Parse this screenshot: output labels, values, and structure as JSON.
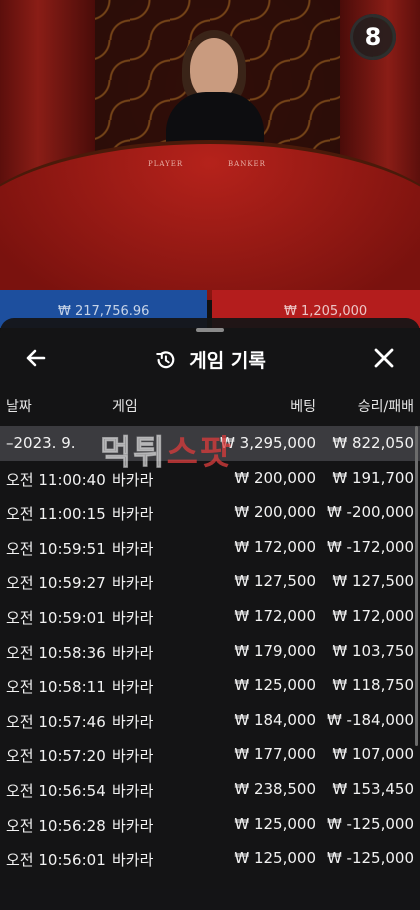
{
  "game_view": {
    "timer_value": "8",
    "player_total": "₩ 217,756.96",
    "banker_total": "₩ 1,205,000",
    "table_labels": [
      "PLAYER",
      "BANKER"
    ]
  },
  "modal": {
    "title": "게임 기록",
    "columns": {
      "date": "날짜",
      "game": "게임",
      "bet": "베팅",
      "win_loss": "승리/패배"
    },
    "rows": [
      {
        "date": "–2023. 9.",
        "game": "",
        "bet": "₩ 3,295,000",
        "win_loss": "₩ 822,050"
      },
      {
        "date": "오전 11:00:40",
        "game": "바카라",
        "bet": "₩ 200,000",
        "win_loss": "₩ 191,700"
      },
      {
        "date": "오전 11:00:15",
        "game": "바카라",
        "bet": "₩ 200,000",
        "win_loss": "₩ -200,000"
      },
      {
        "date": "오전 10:59:51",
        "game": "바카라",
        "bet": "₩ 172,000",
        "win_loss": "₩ -172,000"
      },
      {
        "date": "오전 10:59:27",
        "game": "바카라",
        "bet": "₩ 127,500",
        "win_loss": "₩ 127,500"
      },
      {
        "date": "오전 10:59:01",
        "game": "바카라",
        "bet": "₩ 172,000",
        "win_loss": "₩ 172,000"
      },
      {
        "date": "오전 10:58:36",
        "game": "바카라",
        "bet": "₩ 179,000",
        "win_loss": "₩ 103,750"
      },
      {
        "date": "오전 10:58:11",
        "game": "바카라",
        "bet": "₩ 125,000",
        "win_loss": "₩ 118,750"
      },
      {
        "date": "오전 10:57:46",
        "game": "바카라",
        "bet": "₩ 184,000",
        "win_loss": "₩ -184,000"
      },
      {
        "date": "오전 10:57:20",
        "game": "바카라",
        "bet": "₩ 177,000",
        "win_loss": "₩ 107,000"
      },
      {
        "date": "오전 10:56:54",
        "game": "바카라",
        "bet": "₩ 238,500",
        "win_loss": "₩ 153,450"
      },
      {
        "date": "오전 10:56:28",
        "game": "바카라",
        "bet": "₩ 125,000",
        "win_loss": "₩ -125,000"
      },
      {
        "date": "오전 10:56:01",
        "game": "바카라",
        "bet": "₩ 125,000",
        "win_loss": "₩ -125,000"
      }
    ]
  },
  "watermark": {
    "part1": "먹튀",
    "part2": "스팟"
  },
  "colors": {
    "player": "#1d4f9e",
    "banker": "#b41d1d",
    "highlight_row": "#3b3b3f",
    "timer_ring": "#2fb34a"
  }
}
